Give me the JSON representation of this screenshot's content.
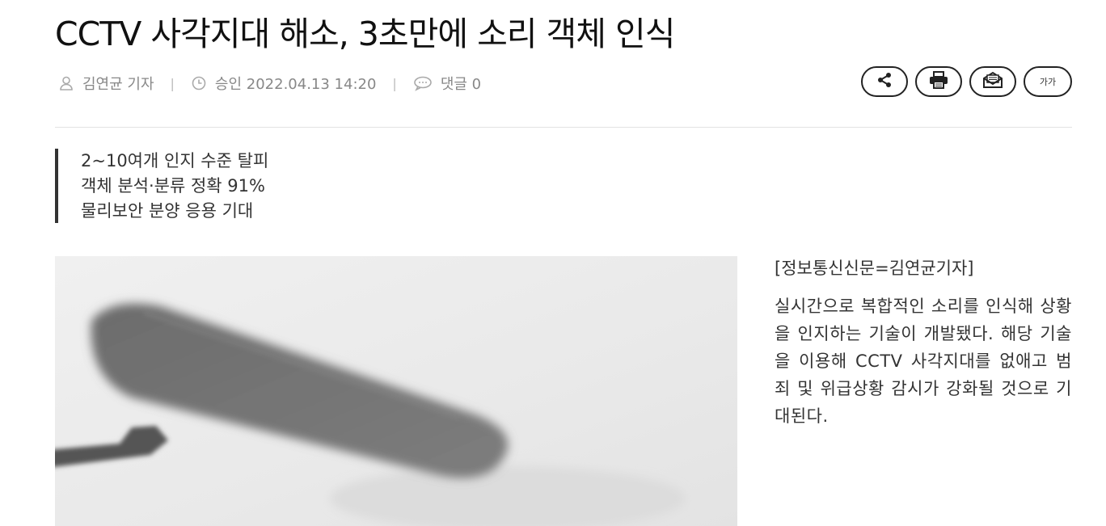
{
  "article": {
    "title": "CCTV 사각지대 해소, 3초만에 소리 객체 인식",
    "meta": {
      "author": "김연균 기자",
      "approval": "승인 2022.04.13 14:20",
      "comments": "댓글 0",
      "separator": "|"
    },
    "tools": {
      "share_icon": "share-icon",
      "print_icon": "print-icon",
      "email_icon": "email-icon",
      "font_size_label": "가가"
    },
    "summary": [
      "2~10여개 인지 수준 탈피",
      "객체 분석·분류 정확 91%",
      "물리보안 분양 응용 기대"
    ],
    "byline": "[정보통신신문=김연균기자]",
    "body": "실시간으로 복합적인 소리를 인식해 상황을 인지하는 기술이 개발됐다. 해당 기술을 이용해 CCTV 사각지대를 없애고 범죄 및 위급상황 감시가 강화될 것으로 기대된다."
  }
}
